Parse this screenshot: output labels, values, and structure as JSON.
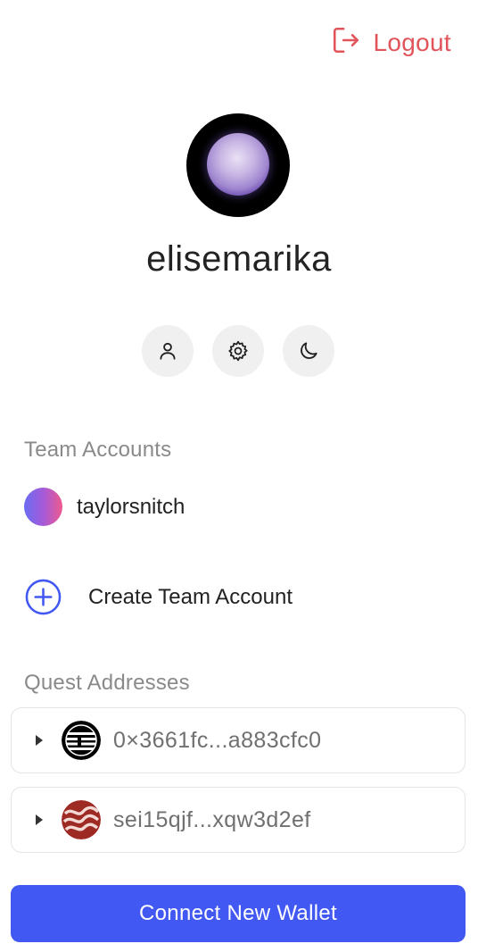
{
  "header": {
    "logout_label": "Logout",
    "logout_icon": "logout-icon"
  },
  "profile": {
    "username": "elisemarika",
    "actions": [
      {
        "icon": "user-icon"
      },
      {
        "icon": "gear-icon"
      },
      {
        "icon": "moon-icon"
      }
    ]
  },
  "team_accounts": {
    "heading": "Team Accounts",
    "items": [
      {
        "name": "taylorsnitch"
      }
    ],
    "create_label": "Create Team Account",
    "create_icon": "plus-circle-icon"
  },
  "quest_addresses": {
    "heading": "Quest Addresses",
    "items": [
      {
        "address": "0×3661fc...a883cfc0",
        "logo": "ethereum-stripes-logo"
      },
      {
        "address": "sei15qjf...xqw3d2ef",
        "logo": "sei-waves-logo"
      }
    ]
  },
  "footer": {
    "connect_label": "Connect New Wallet"
  },
  "colors": {
    "accent": "#4158f2",
    "logout": "#e0545a",
    "muted_text": "#8a8a8a"
  }
}
